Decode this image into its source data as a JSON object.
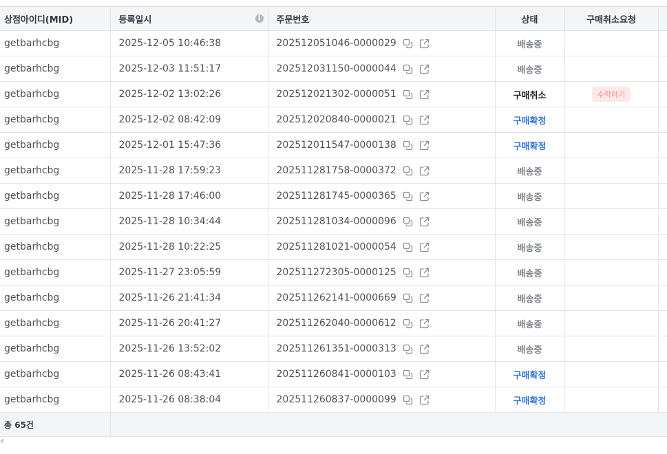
{
  "table": {
    "headers": {
      "mid": "상점아이디(MID)",
      "date": "등록일시",
      "order": "주문번호",
      "status": "상태",
      "cancel_request": "구매취소요청"
    },
    "info_icon": "info-icon",
    "icons": {
      "copy": "copy-icon",
      "open": "external-link-icon"
    },
    "status_colors": {
      "배송중": "#7e838b",
      "구매취소": "#1f2328",
      "구매확정": "#2f77d6"
    },
    "accept_label": "수락하기",
    "rows": [
      {
        "mid": "getbarhcbg",
        "date": "2025-12-05 10:46:38",
        "order": "202512051046-0000029",
        "status": "배송중",
        "cancel": ""
      },
      {
        "mid": "getbarhcbg",
        "date": "2025-12-03 11:51:17",
        "order": "202512031150-0000044",
        "status": "배송중",
        "cancel": ""
      },
      {
        "mid": "getbarhcbg",
        "date": "2025-12-02 13:02:26",
        "order": "202512021302-0000051",
        "status": "구매취소",
        "cancel": "수락하기"
      },
      {
        "mid": "getbarhcbg",
        "date": "2025-12-02 08:42:09",
        "order": "202512020840-0000021",
        "status": "구매확정",
        "cancel": ""
      },
      {
        "mid": "getbarhcbg",
        "date": "2025-12-01 15:47:36",
        "order": "202512011547-0000138",
        "status": "구매확정",
        "cancel": ""
      },
      {
        "mid": "getbarhcbg",
        "date": "2025-11-28 17:59:23",
        "order": "202511281758-0000372",
        "status": "배송중",
        "cancel": ""
      },
      {
        "mid": "getbarhcbg",
        "date": "2025-11-28 17:46:00",
        "order": "202511281745-0000365",
        "status": "배송중",
        "cancel": ""
      },
      {
        "mid": "getbarhcbg",
        "date": "2025-11-28 10:34:44",
        "order": "202511281034-0000096",
        "status": "배송중",
        "cancel": ""
      },
      {
        "mid": "getbarhcbg",
        "date": "2025-11-28 10:22:25",
        "order": "202511281021-0000054",
        "status": "배송중",
        "cancel": ""
      },
      {
        "mid": "getbarhcbg",
        "date": "2025-11-27 23:05:59",
        "order": "202511272305-0000125",
        "status": "배송중",
        "cancel": ""
      },
      {
        "mid": "getbarhcbg",
        "date": "2025-11-26 21:41:34",
        "order": "202511262141-0000669",
        "status": "배송중",
        "cancel": ""
      },
      {
        "mid": "getbarhcbg",
        "date": "2025-11-26 20:41:27",
        "order": "202511262040-0000612",
        "status": "배송중",
        "cancel": ""
      },
      {
        "mid": "getbarhcbg",
        "date": "2025-11-26 13:52:02",
        "order": "202511261351-0000313",
        "status": "배송중",
        "cancel": ""
      },
      {
        "mid": "getbarhcbg",
        "date": "2025-11-26 08:43:41",
        "order": "202511260841-0000103",
        "status": "구매확정",
        "cancel": ""
      },
      {
        "mid": "getbarhcbg",
        "date": "2025-11-26 08:38:04",
        "order": "202511260837-0000099",
        "status": "구매확정",
        "cancel": ""
      }
    ],
    "footer": {
      "total": "총 65건"
    }
  }
}
